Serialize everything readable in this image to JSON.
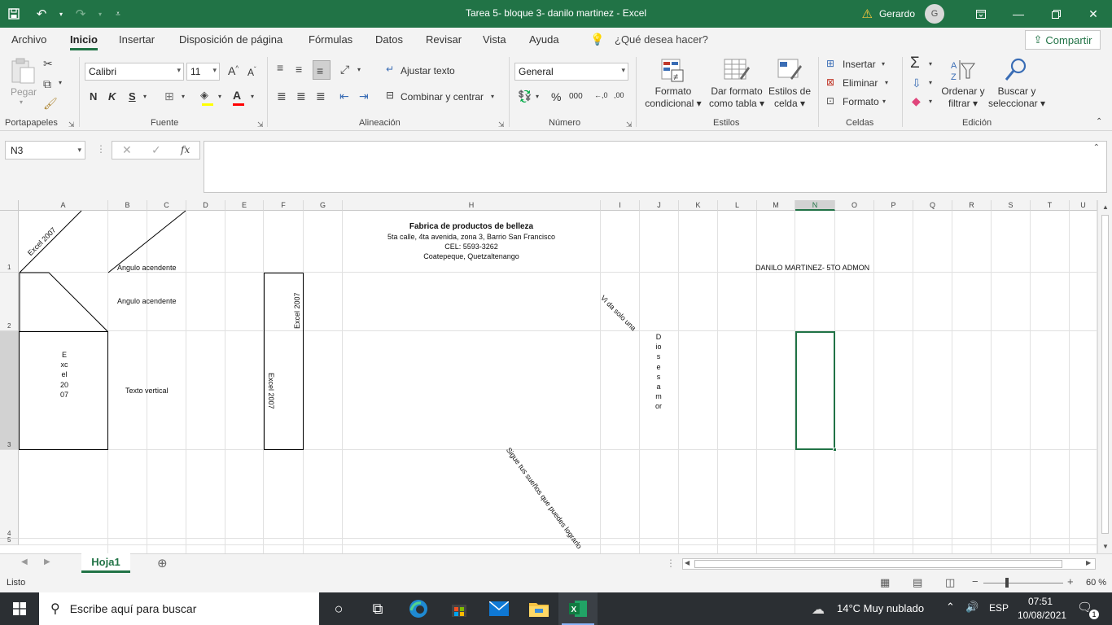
{
  "window": {
    "title": "Tarea 5- bloque 3- danilo martinez  -  Excel",
    "user": "Gerardo",
    "user_initial": "G"
  },
  "menu": {
    "tabs": [
      "Archivo",
      "Inicio",
      "Insertar",
      "Disposición de página",
      "Fórmulas",
      "Datos",
      "Revisar",
      "Vista",
      "Ayuda"
    ],
    "active_tab": "Inicio",
    "tell_me": "¿Qué desea hacer?",
    "share": "Compartir"
  },
  "ribbon": {
    "portapapeles": {
      "label": "Portapapeles",
      "paste": "Pegar"
    },
    "fuente": {
      "label": "Fuente",
      "font_name": "Calibri",
      "font_size": "11",
      "bold": "N",
      "italic": "K",
      "underline": "S",
      "grow": "A",
      "shrink": "A"
    },
    "alineacion": {
      "label": "Alineación",
      "wrap": "Ajustar texto",
      "merge": "Combinar y centrar"
    },
    "numero": {
      "label": "Número",
      "format": "General",
      "percent": "%",
      "thousands": "000"
    },
    "estilos": {
      "label": "Estilos",
      "cond_format_1": "Formato",
      "cond_format_2": "condicional",
      "as_table_1": "Dar formato",
      "as_table_2": "como tabla",
      "cell_styles_1": "Estilos de",
      "cell_styles_2": "celda"
    },
    "celdas": {
      "label": "Celdas",
      "insert": "Insertar",
      "delete": "Eliminar",
      "format": "Formato"
    },
    "edicion": {
      "label": "Edición",
      "sort_1": "Ordenar y",
      "sort_2": "filtrar",
      "find_1": "Buscar y",
      "find_2": "seleccionar"
    }
  },
  "formula_bar": {
    "name_box": "N3",
    "fx": "fx",
    "value": ""
  },
  "sheet": {
    "columns": [
      "A",
      "B",
      "C",
      "D",
      "E",
      "F",
      "G",
      "H",
      "I",
      "J",
      "K",
      "L",
      "M",
      "N",
      "O",
      "P",
      "Q",
      "R",
      "S",
      "T",
      "U"
    ],
    "selected_column": "N",
    "rows": [
      "1",
      "2",
      "3",
      "4",
      "5"
    ],
    "selected_row": "3",
    "cells": {
      "A1": "Excel 2007",
      "B1": "Angulo acendente",
      "B2": "Angulo acendente",
      "A3": "Excel 2007",
      "B3": "Texto vertical",
      "F2": "Excel 2007",
      "F3": "Excel 2007",
      "H1_title": "Fabrica de productos de belleza",
      "H1_line2": "5ta calle, 4ta avenida, zona 3, Barrio San Francisco",
      "H1_line3": "CEL: 5593-3262",
      "H1_line4": "Coatepeque, Quetzaltenango",
      "I2": "Vi da solo una",
      "J3": "Dios es amor",
      "N1": "DANILO MARTINEZ- 5TO ADMON",
      "H4": "Sigue tus sueños que puedes lograrlo"
    }
  },
  "sheet_tabs": {
    "active": "Hoja1"
  },
  "status": {
    "ready": "Listo",
    "zoom": "60 %"
  },
  "taskbar": {
    "search_placeholder": "Escribe aquí para buscar",
    "weather": "14°C  Muy nublado",
    "lang": "ESP",
    "time": "07:51",
    "date": "10/08/2021",
    "notifications": "1"
  }
}
